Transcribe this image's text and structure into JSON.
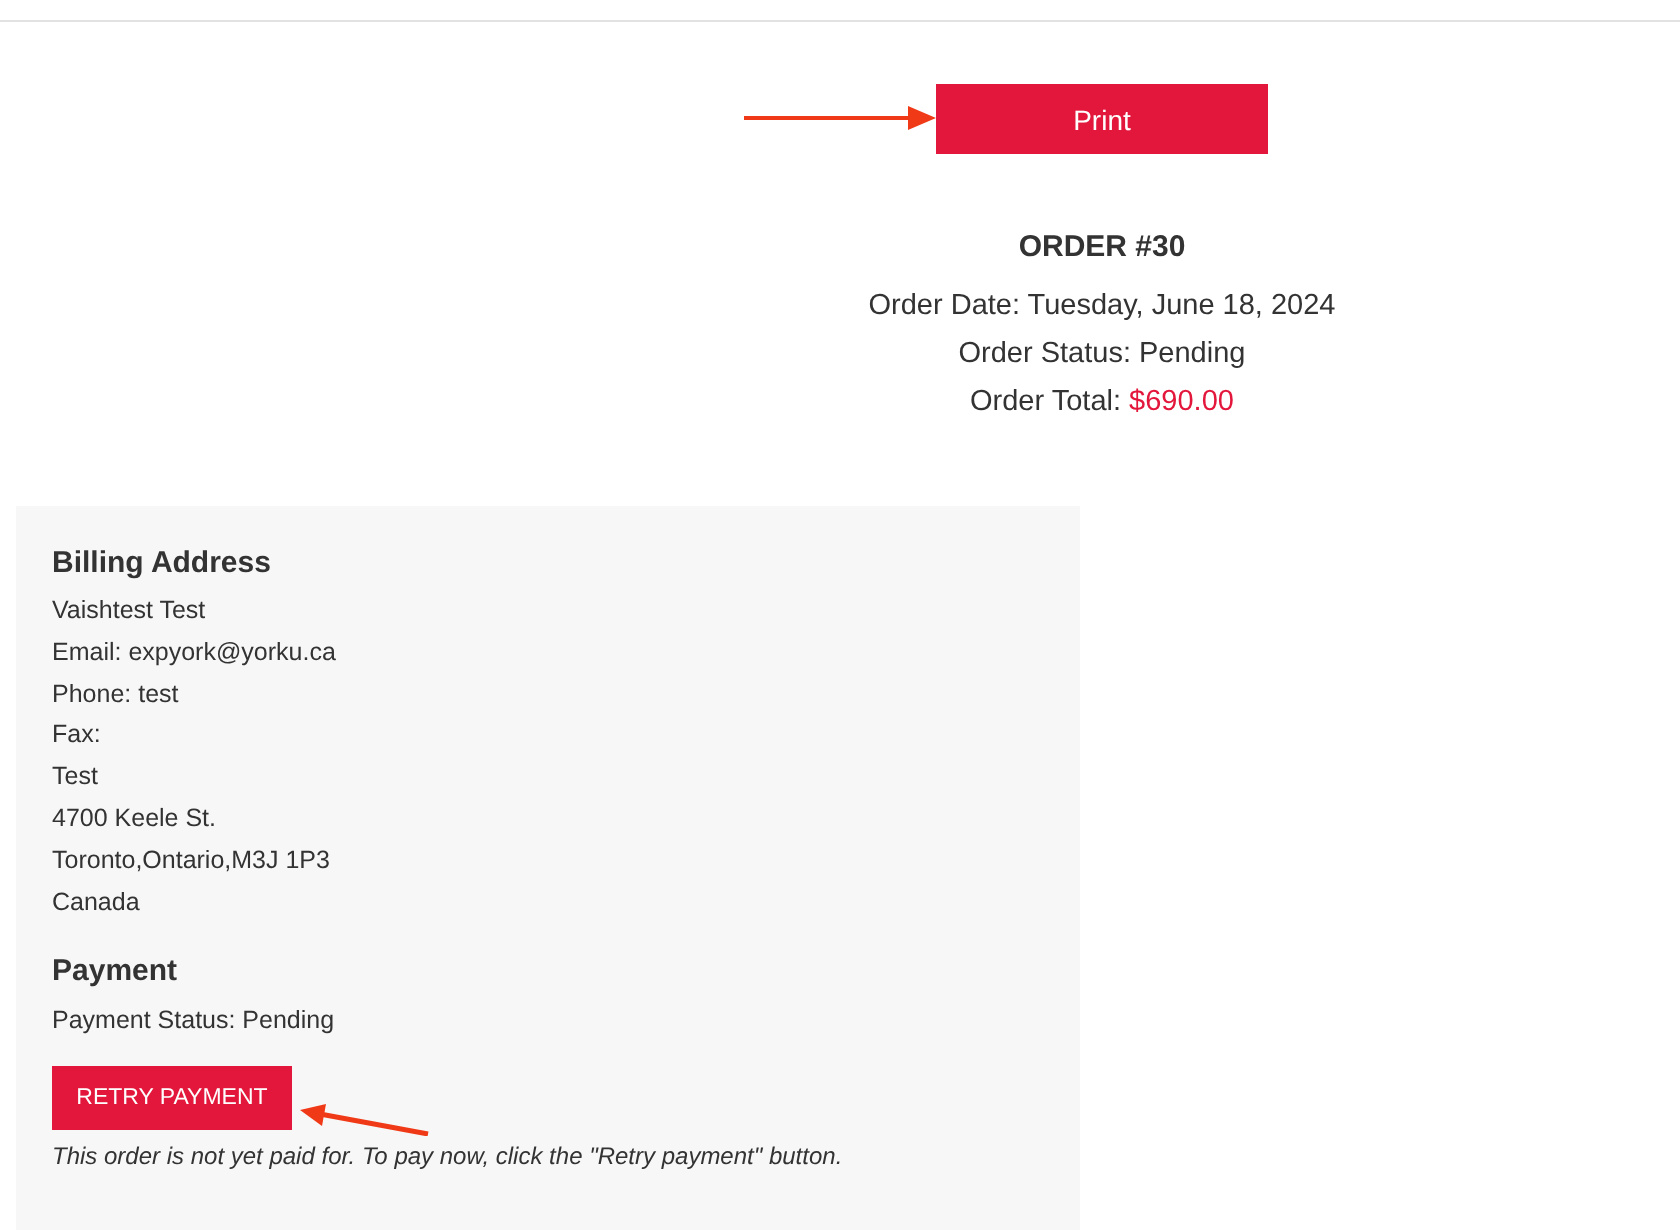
{
  "print_button": {
    "label": "Print"
  },
  "order": {
    "title": "ORDER #30",
    "date": "Order Date: Tuesday, June 18, 2024",
    "status": "Order Status: Pending",
    "total_label": "Order Total:",
    "total_value": "$690.00"
  },
  "billing": {
    "heading": "Billing Address",
    "lines": [
      "Vaishtest Test",
      "Email: expyork@yorku.ca",
      "Phone: test",
      "Fax:",
      "Test",
      "4700 Keele St.",
      "Toronto,Ontario,M3J 1P3",
      "Canada"
    ]
  },
  "payment": {
    "heading": "Payment",
    "status": "Payment Status: Pending",
    "retry_button": {
      "label": "RETRY PAYMENT"
    },
    "note": "This order is not yet paid for. To pay now, click the \"Retry payment\" button."
  }
}
